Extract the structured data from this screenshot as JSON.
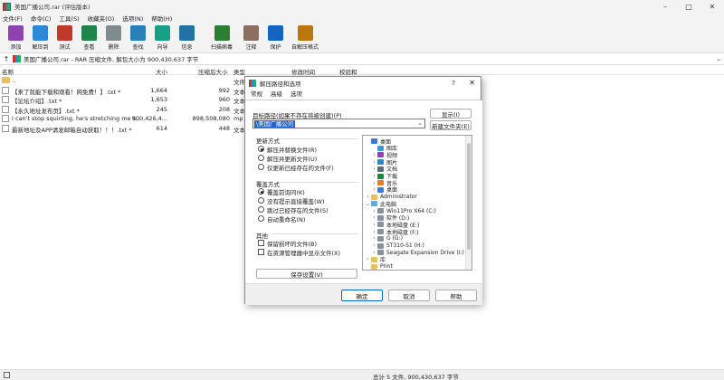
{
  "window": {
    "title": "美国广播公司.rar (评估版本)"
  },
  "menu": [
    "文件(F)",
    "命令(C)",
    "工具(S)",
    "收藏夹(O)",
    "选项(N)",
    "帮助(H)"
  ],
  "toolbar": [
    {
      "label": "添加",
      "color": "#8e44ad",
      "icon": "add-archive-icon"
    },
    {
      "label": "解压到",
      "color": "#2d89d6",
      "icon": "extract-to-icon"
    },
    {
      "label": "测试",
      "color": "#c0392b",
      "icon": "test-icon"
    },
    {
      "label": "查看",
      "color": "#1e8449",
      "icon": "view-book-icon"
    },
    {
      "label": "删除",
      "color": "#7f8c8d",
      "icon": "delete-icon"
    },
    {
      "label": "查找",
      "color": "#2980b9",
      "icon": "find-icon"
    },
    {
      "label": "向导",
      "color": "#16a085",
      "icon": "wizard-icon"
    },
    {
      "label": "信息",
      "color": "#2471a3",
      "icon": "info-icon"
    },
    {
      "label": "扫描病毒",
      "color": "#2e7d32",
      "icon": "virus-scan-icon"
    },
    {
      "label": "注释",
      "color": "#8d6e63",
      "icon": "comment-icon"
    },
    {
      "label": "保护",
      "color": "#1565c0",
      "icon": "protect-shield-icon"
    },
    {
      "label": "自解压格式",
      "color": "#b9770e",
      "icon": "sfx-icon"
    }
  ],
  "address": {
    "text": "美国广播公司.rar - RAR 压缩文件, 解包大小为 900,430,637 字节"
  },
  "columns": {
    "name": "名称",
    "size": "大小",
    "packed": "压缩后大小",
    "type": "类型",
    "modified": "修改时间",
    "crc": "校验和"
  },
  "files": [
    {
      "name": "..",
      "size": "",
      "packed": "",
      "type": "文件",
      "folder": true
    },
    {
      "name": "【来了就能下载和观看！网免费！】.txt *",
      "size": "1,664",
      "packed": "992",
      "type": "文本"
    },
    {
      "name": "【论坛介绍】.txt *",
      "size": "1,653",
      "packed": "960",
      "type": "文本"
    },
    {
      "name": "【永久地址发布页】.txt *",
      "size": "245",
      "packed": "208",
      "type": "文本"
    },
    {
      "name": "I can't stop squirting, he's stretching me s...",
      "size": "900,426,4...",
      "packed": "898,508,080",
      "type": "mp"
    },
    {
      "name": "最新地址及APP请发邮箱自动获取！！！.txt *",
      "size": "614",
      "packed": "448",
      "type": "文本"
    }
  ],
  "status": {
    "text": "总计 5 文件, 900,430,637 字节"
  },
  "dialog": {
    "title": "解压路径和选项",
    "help": "?",
    "tabs": [
      "常规",
      "高级",
      "选项"
    ],
    "path_label": "目标路径(如果不存在将被创建)(P)",
    "path_value": "\\美国广播公司",
    "show_button": "显示(I)",
    "new_folder_button": "新建文件夹(E)",
    "update_group": "更新方式",
    "update_options": [
      {
        "label": "解压并替换文件(R)",
        "checked": true
      },
      {
        "label": "解压并更新文件(U)",
        "checked": false
      },
      {
        "label": "仅更新已经存在的文件(F)",
        "checked": false
      }
    ],
    "overwrite_group": "覆盖方式",
    "overwrite_options": [
      {
        "label": "覆盖前询问(K)",
        "checked": true
      },
      {
        "label": "没有提示直接覆盖(W)",
        "checked": false
      },
      {
        "label": "跳过已经存在的文件(S)",
        "checked": false
      },
      {
        "label": "自动重命名(N)",
        "checked": false
      }
    ],
    "misc_group": "其他",
    "misc_options": [
      {
        "label": "保留损坏的文件(B)",
        "checked": false
      },
      {
        "label": "在资源管理器中显示文件(X)",
        "checked": false
      }
    ],
    "save_settings_button": "保存设置(V)",
    "ok_button": "确定",
    "cancel_button": "取消",
    "help_button": "帮助",
    "tree": [
      {
        "label": "桌面",
        "indent": 0,
        "exp": "",
        "color": "#3a7bd5"
      },
      {
        "label": "图库",
        "indent": 1,
        "exp": "",
        "color": "#3498db"
      },
      {
        "label": "视频",
        "indent": 1,
        "exp": "›",
        "color": "#8e44ad"
      },
      {
        "label": "图片",
        "indent": 1,
        "exp": "›",
        "color": "#2e86c1"
      },
      {
        "label": "文档",
        "indent": 1,
        "exp": "›",
        "color": "#5d6d7e"
      },
      {
        "label": "下载",
        "indent": 1,
        "exp": "›",
        "color": "#1e8449"
      },
      {
        "label": "音乐",
        "indent": 1,
        "exp": "›",
        "color": "#e67e22"
      },
      {
        "label": "桌面",
        "indent": 1,
        "exp": "›",
        "color": "#3a7bd5"
      },
      {
        "label": "Administrator",
        "indent": 0,
        "exp": "›",
        "color": "#e9c35a"
      },
      {
        "label": "此电脑",
        "indent": 0,
        "exp": "⌄",
        "color": "#5dade2"
      },
      {
        "label": "Win11Pro X64 (C:)",
        "indent": 1,
        "exp": "›",
        "color": "#85929e"
      },
      {
        "label": "软件 (D:)",
        "indent": 1,
        "exp": "›",
        "color": "#85929e"
      },
      {
        "label": "本地磁盘 (E:)",
        "indent": 1,
        "exp": "›",
        "color": "#85929e"
      },
      {
        "label": "本地磁盘 (F:)",
        "indent": 1,
        "exp": "›",
        "color": "#85929e"
      },
      {
        "label": "G (G:)",
        "indent": 1,
        "exp": "›",
        "color": "#85929e"
      },
      {
        "label": "ST310-S1 (H:)",
        "indent": 1,
        "exp": "›",
        "color": "#85929e"
      },
      {
        "label": "Seagate Expansion Drive (I:)",
        "indent": 1,
        "exp": "›",
        "color": "#85929e"
      },
      {
        "label": "库",
        "indent": 0,
        "exp": "›",
        "color": "#e9c35a"
      },
      {
        "label": "Print",
        "indent": 0,
        "exp": "",
        "color": "#e9c35a"
      }
    ]
  }
}
